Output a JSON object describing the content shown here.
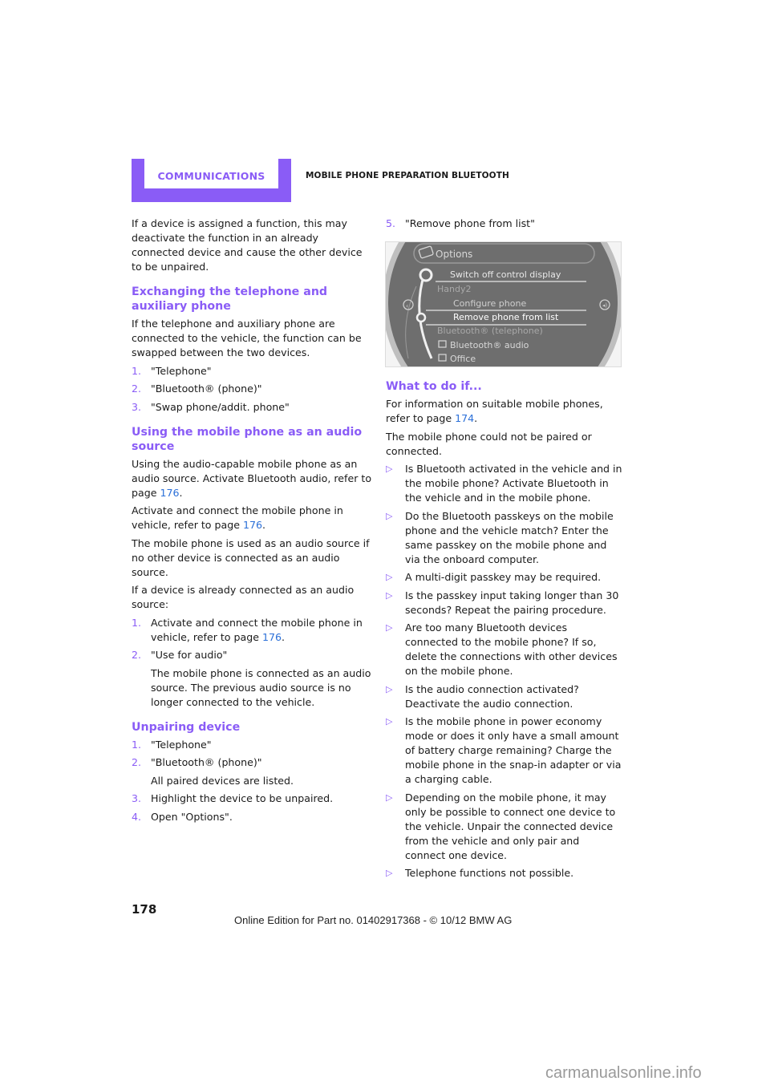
{
  "header": {
    "section_tab": "COMMUNICATIONS",
    "chapter_title": "MOBILE PHONE PREPARATION BLUETOOTH",
    "accent_color": "#8a5cf6"
  },
  "left": {
    "intro": "If a device is assigned a function, this may deactivate the function in an already connected device and cause the other device to be unpaired.",
    "exchange": {
      "heading": "Exchanging the telephone and auxiliary phone",
      "text": "If the telephone and auxiliary phone are connected to the vehicle, the function can be swapped between the two devices.",
      "steps": [
        {
          "num": "1.",
          "text": "\"Telephone\""
        },
        {
          "num": "2.",
          "text": "\"Bluetooth® (phone)\""
        },
        {
          "num": "3.",
          "text": "\"Swap phone/addit. phone\""
        }
      ]
    },
    "audio": {
      "heading": "Using the mobile phone as an audio source",
      "p1_text": "Using the audio-capable mobile phone as an audio source. Activate Bluetooth audio, refer to page ",
      "p1_link": "176",
      "p2_text": "Activate and connect the mobile phone in vehicle, refer to page ",
      "p2_link": "176",
      "p3": "The mobile phone is used as an audio source if no other device is connected as an audio source.",
      "p4": "If a device is already connected as an audio source:",
      "step1_num": "1.",
      "step1_text": "Activate and connect the mobile phone in vehicle, refer to page ",
      "step1_link": "176",
      "step2_num": "2.",
      "step2_text": "\"Use for audio\"",
      "step2_note": "The mobile phone is connected as an audio source. The previous audio source is no longer connected to the vehicle."
    },
    "unpair": {
      "heading": "Unpairing device",
      "step1_num": "1.",
      "step1_text": "\"Telephone\"",
      "step2_num": "2.",
      "step2_text": "\"Bluetooth® (phone)\"",
      "step2_note": "All paired devices are listed.",
      "step3_num": "3.",
      "step3_text": "Highlight the device to be unpaired.",
      "step4_num": "4.",
      "step4_text": "Open \"Options\"."
    }
  },
  "right": {
    "step5_num": "5.",
    "step5_text": "\"Remove phone from list\"",
    "screen": {
      "title": "Options",
      "items": [
        {
          "label": "Switch off control display",
          "indent": 2,
          "selected": false
        },
        {
          "label": "Handy2",
          "indent": 0,
          "selected": false
        },
        {
          "label": "Configure phone",
          "indent": 2,
          "selected": false
        },
        {
          "label": "Remove phone from list",
          "indent": 2,
          "selected": true
        },
        {
          "label": "Bluetooth® (telephone)",
          "indent": 0,
          "selected": false
        },
        {
          "label": "Bluetooth® audio",
          "indent": 1,
          "selected": false,
          "checked": true
        },
        {
          "label": "Office",
          "indent": 1,
          "selected": false,
          "checked": true
        }
      ]
    },
    "whattodo": {
      "heading": "What to do if...",
      "p1_text": "For information on suitable mobile phones, refer to page ",
      "p1_link": "174",
      "p2": "The mobile phone could not be paired or connected.",
      "bullets": [
        "Is Bluetooth activated in the vehicle and in the mobile phone? Activate Bluetooth in the vehicle and in the mobile phone.",
        "Do the Bluetooth passkeys on the mobile phone and the vehicle match? Enter the same passkey on the mobile phone and via the onboard computer.",
        "A multi-digit passkey may be required.",
        "Is the passkey input taking longer than 30 seconds? Repeat the pairing procedure.",
        "Are too many Bluetooth devices connected to the mobile phone? If so, delete the connections with other devices on the mobile phone.",
        "Is the audio connection activated? Deactivate the audio connection.",
        "Is the mobile phone in power economy mode or does it only have a small amount of battery charge remaining? Charge the mobile phone in the snap-in adapter or via a charging cable.",
        "Depending on the mobile phone, it may only be possible to connect one device to the vehicle. Unpair the connected device from the vehicle and only pair and connect one device.",
        "Telephone functions not possible."
      ],
      "bullet_glyph": "▷"
    }
  },
  "footer": {
    "page_number": "178",
    "edition": "Online Edition for Part no. 01402917368 - © 10/12 BMW AG",
    "watermark": "carmanualsonline.info"
  }
}
